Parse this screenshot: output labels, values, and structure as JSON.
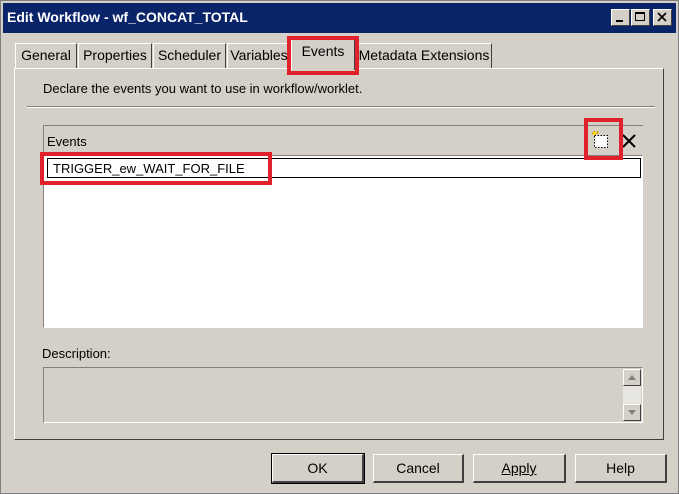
{
  "window": {
    "title": "Edit Workflow - wf_CONCAT_TOTAL"
  },
  "tabs": [
    {
      "label": "General"
    },
    {
      "label": "Properties"
    },
    {
      "label": "Scheduler"
    },
    {
      "label": "Variables"
    },
    {
      "label": "Events",
      "selected": true
    },
    {
      "label": "Metadata Extensions"
    }
  ],
  "events_tab": {
    "instruction": "Declare the events you want to use in workflow/worklet.",
    "grid_header": "Events",
    "rows": [
      "TRIGGER_ew_WAIT_FOR_FILE"
    ],
    "description_label": "Description:",
    "description_value": ""
  },
  "icons": {
    "add": "new-event-icon",
    "delete": "delete-icon"
  },
  "buttons": {
    "ok": "OK",
    "cancel": "Cancel",
    "apply": "Apply",
    "help": "Help"
  },
  "colors": {
    "titlebar": "#0a246a",
    "highlight": "#e0202a",
    "dialog_bg": "#d4d0c8"
  }
}
